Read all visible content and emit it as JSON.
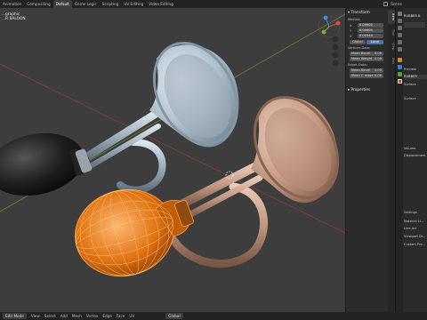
{
  "top_bar": {
    "tabs": [
      "Animation",
      "Compositing",
      "Default",
      "Game Logic",
      "Scripting",
      "UV Editing",
      "Video Editing"
    ],
    "active_tab": "Default",
    "scene_label": "Scene"
  },
  "viewport": {
    "view_label": "...graphic",
    "object_label": "...R BALOON"
  },
  "transform_panel": {
    "title": "Transform",
    "median_label": "Median:",
    "x_label": "X",
    "x_value": "0.00000",
    "y_label": "Y",
    "y_value": "0.00000",
    "z_label": "Z",
    "z_value": "0.01544",
    "global_label": "Global",
    "local_label": "Local",
    "vertices_data_label": "Vertices Data:",
    "mean_bevel_label": "Mean Bevel",
    "mean_bevel_value": "0.00",
    "mean_weight_label": "Mean Weight",
    "mean_weight_value": "0.00",
    "edges_data_label": "Edges Data:",
    "edge_mean_bevel_label": "Mean Bevel",
    "edge_mean_bevel_value": "0.00",
    "mean_crease_label": "Mean C rease",
    "mean_crease_value": "0.00",
    "properties_title": "Properties"
  },
  "npanel_tabs": [
    "Item",
    "Tool",
    "View",
    "Edit"
  ],
  "properties_editor": {
    "object_name": "RUBBER B",
    "material_name": "RUBBER",
    "surface_tab": "Surface",
    "preview_label": "Preview",
    "rows": [
      "Surface",
      "Volume",
      "Displacement",
      "Settings",
      "Material Li...",
      "Line Art",
      "Viewport Di...",
      "Custom Pro..."
    ]
  },
  "status_bar": {
    "mode": "Edit Mode",
    "items": [
      "View",
      "Select",
      "Add",
      "Mesh",
      "Vertex",
      "Edge",
      "Face",
      "UV"
    ],
    "transform_orientation": "Global"
  },
  "colors": {
    "accent_blue": "#4772b3",
    "selection_orange": "#ff8c1a",
    "copper": "#c99f88",
    "silver": "#a9b9c6"
  }
}
